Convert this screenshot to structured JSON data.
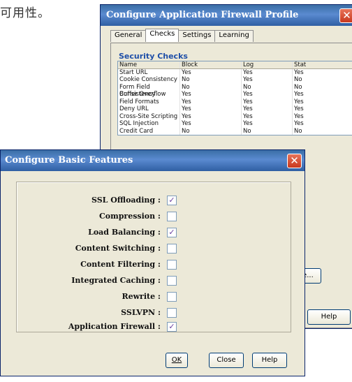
{
  "document_text": "可用性。",
  "firewall_window": {
    "title": "Configure Application Firewall Profile",
    "tabs": [
      {
        "label": "General",
        "accel": ""
      },
      {
        "label": "Checks",
        "accel": ""
      },
      {
        "label": "Settings",
        "accel": ""
      },
      {
        "label": "Learning",
        "accel": ""
      }
    ],
    "group_label": "Security Checks",
    "columns": [
      "Name",
      "Block",
      "Log",
      "Stat"
    ],
    "rows": [
      [
        "Start URL",
        "Yes",
        "Yes",
        "Yes"
      ],
      [
        "Cookie Consistency",
        "No",
        "Yes",
        "No"
      ],
      [
        "Form Field Consistency",
        "No",
        "No",
        "No"
      ],
      [
        "Buffer Overflow",
        "Yes",
        "Yes",
        "Yes"
      ],
      [
        "Field Formats",
        "Yes",
        "Yes",
        "Yes"
      ],
      [
        "Deny URL",
        "Yes",
        "Yes",
        "Yes"
      ],
      [
        "Cross-Site Scripting",
        "Yes",
        "Yes",
        "Yes"
      ],
      [
        "SQL Injection",
        "Yes",
        "Yes",
        "Yes"
      ],
      [
        "Credit Card",
        "No",
        "No",
        "No"
      ]
    ],
    "modify_button_label": "fy Rule...",
    "help_button_label": "Help"
  },
  "basic_features_window": {
    "title": "Configure Basic Features",
    "features": [
      {
        "label": "SSL Offloading :",
        "checked": true
      },
      {
        "label": "Compression :",
        "checked": false
      },
      {
        "label": "Load Balancing :",
        "checked": true
      },
      {
        "label": "Content Switching :",
        "checked": false
      },
      {
        "label": "Content Filtering :",
        "checked": false
      },
      {
        "label": "Integrated Caching :",
        "checked": false
      },
      {
        "label": "Rewrite :",
        "checked": false
      },
      {
        "label": "SSLVPN :",
        "checked": false
      },
      {
        "label": "Application Firewall :",
        "checked": true
      }
    ],
    "buttons": {
      "ok": "OK",
      "close": "Close",
      "help": "Help"
    }
  },
  "icons": {
    "close": "close-icon",
    "check": "checkmark-icon"
  }
}
